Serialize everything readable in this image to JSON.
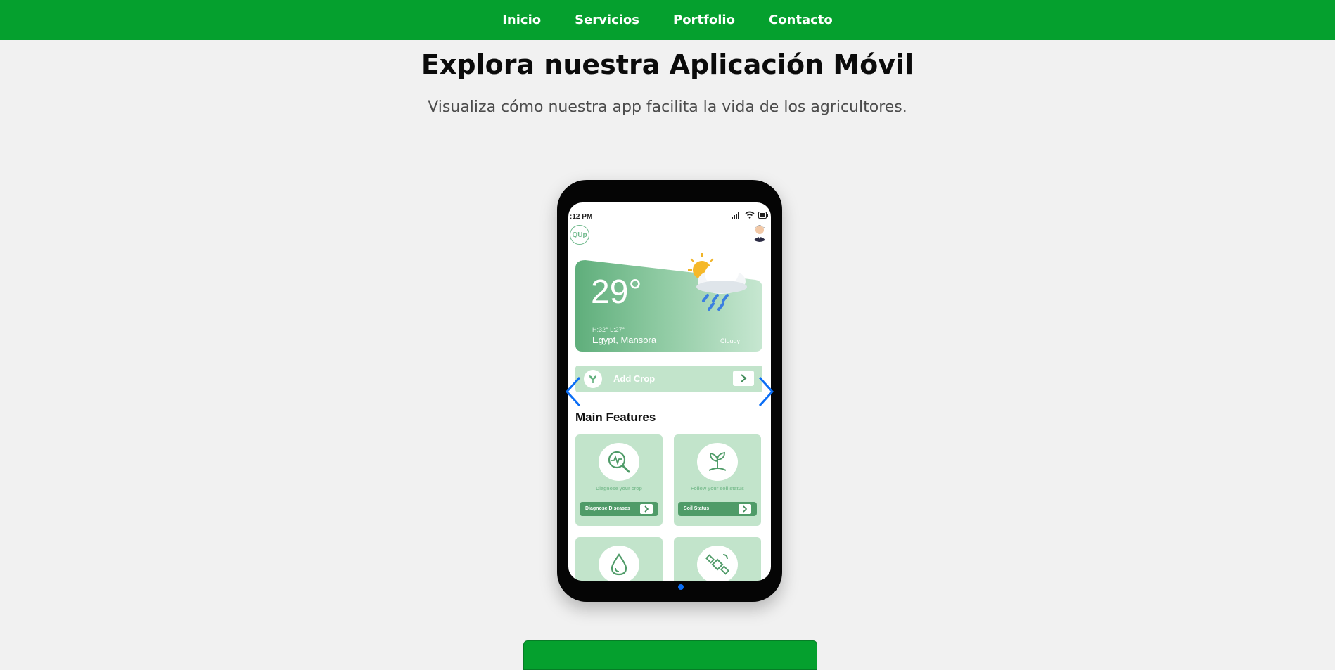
{
  "nav": {
    "items": [
      {
        "label": "Inicio"
      },
      {
        "label": "Servicios"
      },
      {
        "label": "Portfolio"
      },
      {
        "label": "Contacto"
      }
    ]
  },
  "hero": {
    "title": "Explora nuestra Aplicación Móvil",
    "subtitle": "Visualiza cómo nuestra app facilita la vida de los agricultores."
  },
  "phone_app": {
    "status_time": ":12 PM",
    "logo_text": "QUp",
    "weather": {
      "temperature": "29°",
      "high_low": "H:32°   L:27°",
      "location": "Egypt, Mansora",
      "condition": "Cloudy"
    },
    "add_crop_label": "Add Crop",
    "main_features_heading": "Main Features",
    "features": [
      {
        "caption": "Diagnose your crop",
        "button_label": "Diagnose Diseases"
      },
      {
        "caption": "Follow your soil status",
        "button_label": "Soil Status"
      }
    ]
  },
  "colors": {
    "primary_green": "#05a02e",
    "card_green": "#c2e4cb",
    "button_green": "#4f9b68",
    "carousel_blue": "#0b6ef5"
  },
  "carousel": {
    "active_slide": 1,
    "total_slides": 1
  }
}
